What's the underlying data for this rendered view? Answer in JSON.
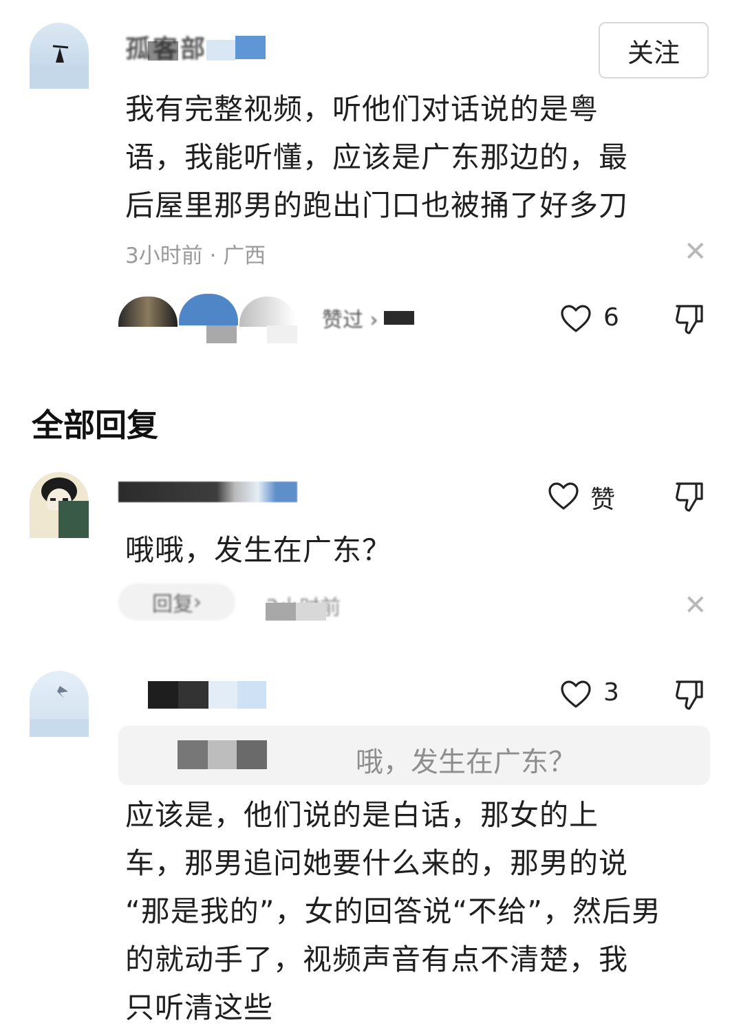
{
  "comment": {
    "username": "孤客部",
    "follow_label": "关注",
    "text_lines": [
      "我有完整视频，听他们对话说的是粤",
      "语，我能听懂，应该是广东那边的，最",
      "后屋里那男的跑出门口也被捅了好多刀"
    ],
    "meta": "3小时前 · 广西",
    "likers_label": "赞过",
    "like_count": "6"
  },
  "replies_section": {
    "title": "全部回复"
  },
  "replies": [
    {
      "like_label": "赞",
      "text": "哦哦，发生在广东？",
      "reply_label": "回复",
      "time": "3小时前"
    },
    {
      "like_count": "3",
      "quote": "哦，发生在广东？",
      "text_lines": [
        "应该是，他们说的是白话，那女的上",
        "车，那男追问她要什么来的，那男的说",
        "“那是我的”，女的回答说“不给”，然后男",
        "的就动手了，视频声音有点不清楚，我",
        "只听清这些"
      ]
    }
  ],
  "icons": {
    "like": "heart-outline-icon",
    "dislike": "thumbs-down-icon",
    "close": "close-icon"
  },
  "colors": {
    "text": "#1f1f1f",
    "meta": "#9a9a9a",
    "quote_bg": "#f3f3f3"
  }
}
